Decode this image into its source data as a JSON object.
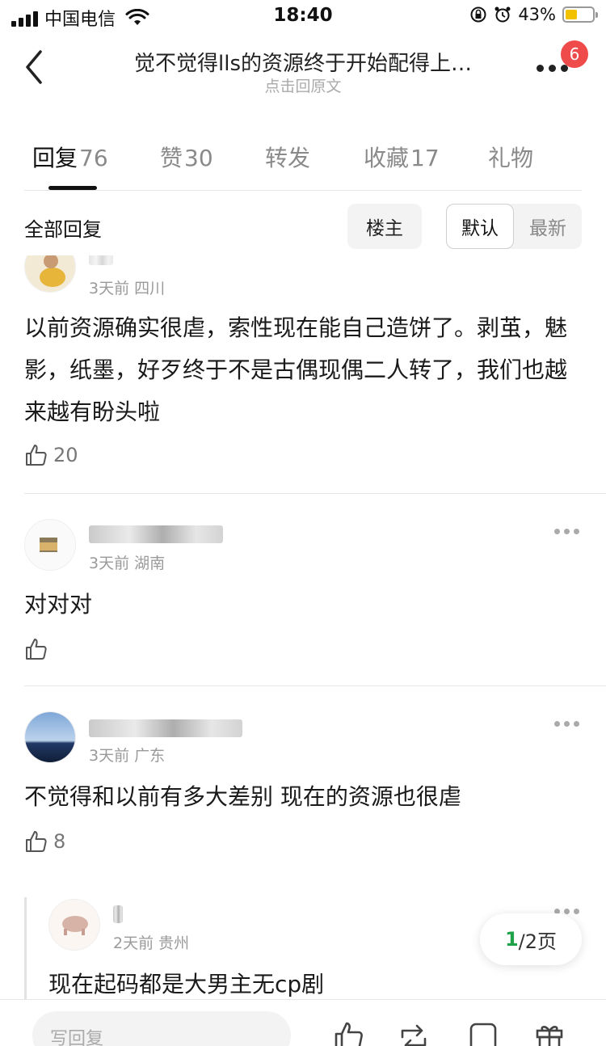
{
  "status_bar": {
    "carrier": "中国电信",
    "time": "18:40",
    "battery": "43%",
    "battery_level": 0.43
  },
  "nav": {
    "title": "觉不觉得lls的资源终于开始配得上…",
    "subtitle": "点击回原文",
    "badge_count": "6"
  },
  "tabs": [
    {
      "label": "回复",
      "count": "76"
    },
    {
      "label": "赞",
      "count": "30"
    },
    {
      "label": "转发",
      "count": ""
    },
    {
      "label": "收藏",
      "count": "17"
    },
    {
      "label": "礼物",
      "count": ""
    }
  ],
  "filter": {
    "title": "全部回复",
    "owner_chip": "楼主",
    "sort_default": "默认",
    "sort_latest": "最新"
  },
  "comments": [
    {
      "time": "3天前",
      "location": "四川",
      "text": "以前资源确实很虐，索性现在能自己造饼了。剥茧，魅影，纸墨，好歹终于不是古偶现偶二人转了，我们也越来越有盼头啦",
      "likes": "20"
    },
    {
      "time": "3天前",
      "location": "湖南",
      "text": "对对对",
      "likes": ""
    },
    {
      "time": "3天前",
      "location": "广东",
      "text": "不觉得和以前有多大差别 现在的资源也很虐",
      "likes": "8"
    },
    {
      "time": "2天前",
      "location": "贵州",
      "text": "现在起码都是大男主无cp剧",
      "likes": ""
    }
  ],
  "pagination": {
    "current": "1",
    "total_text": "/2页"
  },
  "bottom_bar": {
    "write_placeholder": "写回复"
  },
  "colors": {
    "accent_green": "#1fa24a",
    "badge_red": "#f04b4b",
    "battery_yellow": "#f2c200"
  }
}
